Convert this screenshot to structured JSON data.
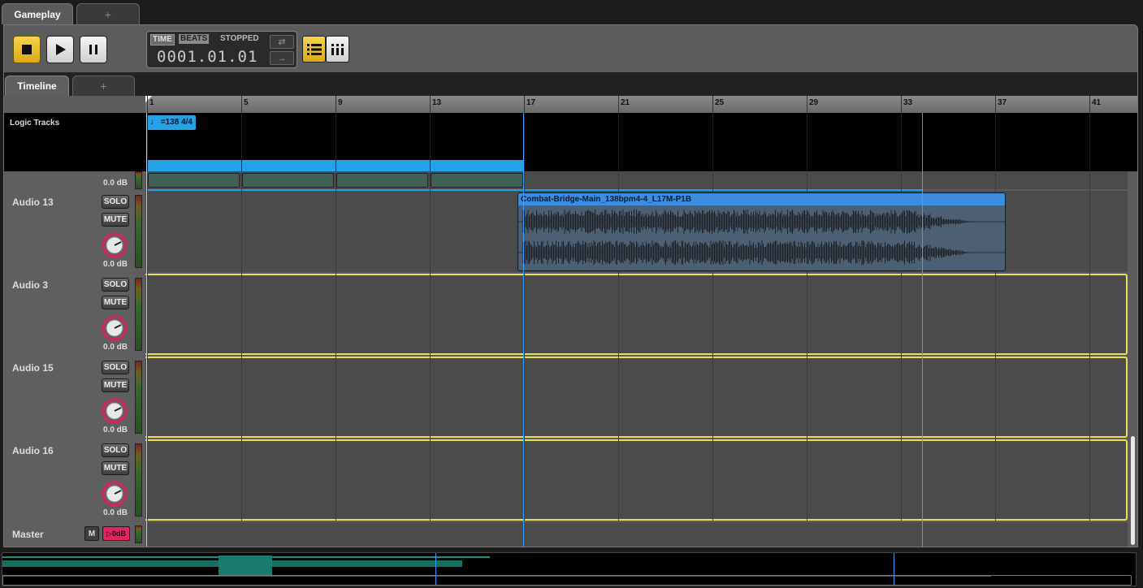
{
  "tabs": {
    "top_active": "Gameplay",
    "top_add": "+"
  },
  "transport": {
    "time_label": "TIME",
    "beats_label": "BEATS",
    "status": "STOPPED",
    "position": "0001.01.01"
  },
  "sub_tabs": {
    "active": "Timeline",
    "add": "+"
  },
  "ruler": {
    "bars": [
      "1",
      "5",
      "9",
      "13",
      "17",
      "21",
      "25",
      "29",
      "33",
      "37",
      "41"
    ]
  },
  "logic": {
    "label": "Logic Tracks",
    "tempo_marker": "♩ =138 4/4"
  },
  "tracks": [
    {
      "name": "",
      "db": "0.0 dB"
    },
    {
      "name": "Audio 13",
      "solo": "SOLO",
      "mute": "MUTE",
      "db": "0.0 dB"
    },
    {
      "name": "Audio 3",
      "solo": "SOLO",
      "mute": "MUTE",
      "db": "0.0 dB"
    },
    {
      "name": "Audio 15",
      "solo": "SOLO",
      "mute": "MUTE",
      "db": "0.0 dB"
    },
    {
      "name": "Audio 16",
      "solo": "SOLO",
      "mute": "MUTE",
      "db": "0.0 dB"
    }
  ],
  "clip": {
    "name": "Combat-Bridge-Main_138bpm4-4_L17M-P1B"
  },
  "master": {
    "name": "Master",
    "m_label": "M",
    "level": "▷0dB"
  },
  "colors": {
    "accent": "#27a1e6",
    "selection": "#e8e05a",
    "transport_yellow": "#f0c431"
  }
}
